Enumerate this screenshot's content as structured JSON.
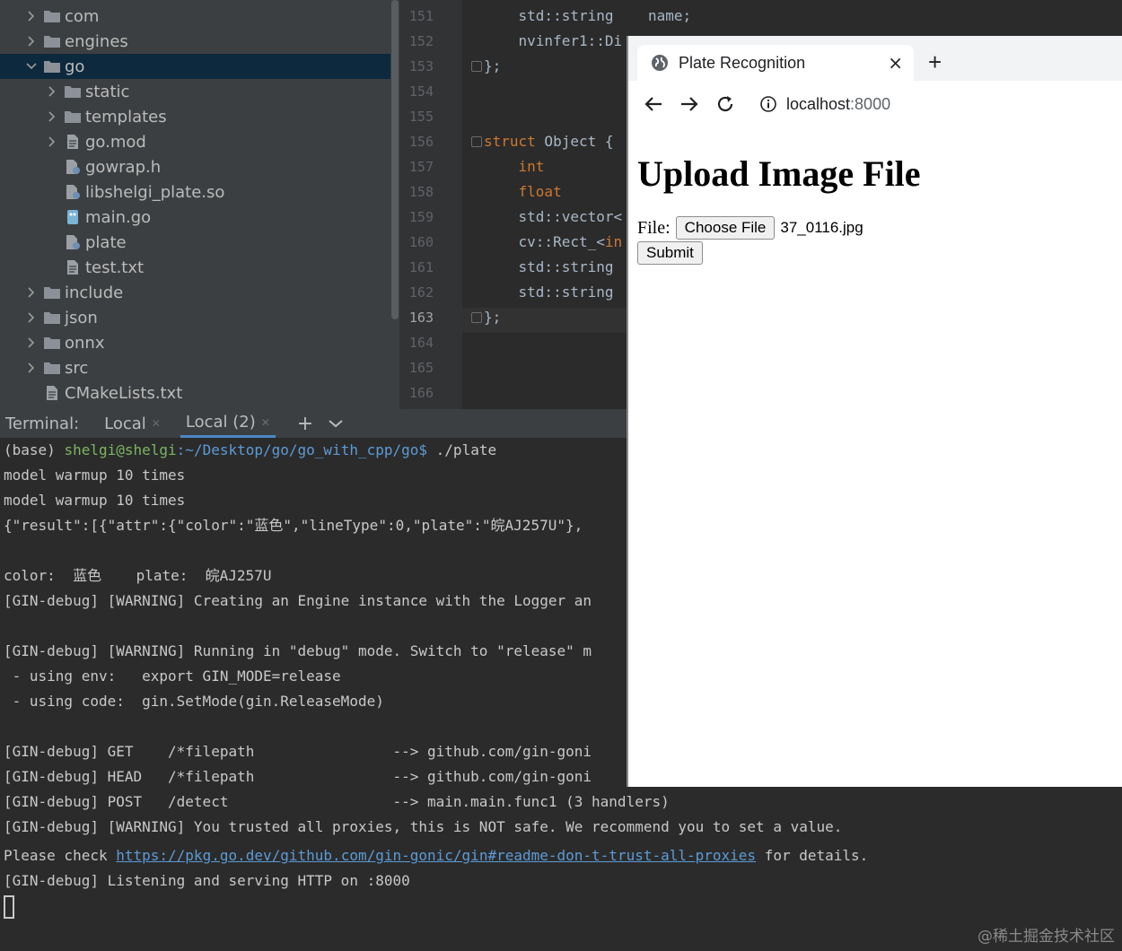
{
  "project_tree": {
    "items": [
      {
        "label": "com",
        "type": "folder",
        "chevron": "›",
        "indent": 0
      },
      {
        "label": "engines",
        "type": "folder",
        "chevron": "›",
        "indent": 0
      },
      {
        "label": "go",
        "type": "folder",
        "chevron": "⌄",
        "indent": 0,
        "selected": true
      },
      {
        "label": "static",
        "type": "folder",
        "chevron": "›",
        "indent": 1
      },
      {
        "label": "templates",
        "type": "folder",
        "chevron": "›",
        "indent": 1
      },
      {
        "label": "go.mod",
        "type": "file",
        "chevron": "›",
        "indent": 1
      },
      {
        "label": "gowrap.h",
        "type": "lib-file",
        "chevron": "",
        "indent": 1
      },
      {
        "label": "libshelgi_plate.so",
        "type": "lib-file",
        "chevron": "",
        "indent": 1
      },
      {
        "label": "main.go",
        "type": "go-file",
        "chevron": "",
        "indent": 1
      },
      {
        "label": "plate",
        "type": "lib-file",
        "chevron": "",
        "indent": 1
      },
      {
        "label": "test.txt",
        "type": "file",
        "chevron": "",
        "indent": 1
      },
      {
        "label": "include",
        "type": "folder",
        "chevron": "›",
        "indent": 0
      },
      {
        "label": "json",
        "type": "folder",
        "chevron": "›",
        "indent": 0
      },
      {
        "label": "onnx",
        "type": "folder",
        "chevron": "›",
        "indent": 0
      },
      {
        "label": "src",
        "type": "folder",
        "chevron": "›",
        "indent": 0
      },
      {
        "label": "CMakeLists.txt",
        "type": "file",
        "chevron": "",
        "indent": 0
      }
    ]
  },
  "editor": {
    "current_line": "163",
    "lines": [
      {
        "num": "151",
        "code": "    std::string    name;",
        "kw": ""
      },
      {
        "num": "152",
        "code": "    nvinfer1::Di",
        "kw": ""
      },
      {
        "num": "153",
        "code": "};",
        "kw": ""
      },
      {
        "num": "154",
        "code": "",
        "kw": ""
      },
      {
        "num": "155",
        "code": "",
        "kw": ""
      },
      {
        "num": "156",
        "code": " Object {",
        "kw": "struct"
      },
      {
        "num": "157",
        "code": "",
        "kw": "    int"
      },
      {
        "num": "158",
        "code": "",
        "kw": "    float"
      },
      {
        "num": "159",
        "code": "    std::vector<",
        "kw": ""
      },
      {
        "num": "160",
        "code": "    cv::Rect_<",
        "kw": "",
        "tail": "in"
      },
      {
        "num": "161",
        "code": "    std::string",
        "kw": ""
      },
      {
        "num": "162",
        "code": "    std::string",
        "kw": ""
      },
      {
        "num": "163",
        "code": "};",
        "kw": ""
      },
      {
        "num": "164",
        "code": "",
        "kw": ""
      },
      {
        "num": "165",
        "code": "",
        "kw": ""
      },
      {
        "num": "166",
        "code": "",
        "kw": ""
      }
    ]
  },
  "terminal_tabs": {
    "title": "Terminal:",
    "tabs": [
      {
        "label": "Local",
        "active": false
      },
      {
        "label": "Local (2)",
        "active": true
      }
    ],
    "add": "+",
    "more": "⌄"
  },
  "terminal": {
    "prompt_env": "(base) ",
    "prompt_user": "shelgi@shelgi",
    "prompt_path": ":~/Desktop/go/go_with_cpp/go$",
    "prompt_cmd": " ./plate",
    "lines": [
      "model warmup 10 times",
      "model warmup 10 times",
      "{\"result\":[{\"attr\":{\"color\":\"蓝色\",\"lineType\":0,\"plate\":\"皖AJ257U\"},",
      "",
      "color:  蓝色    plate:  皖AJ257U",
      "[GIN-debug] [WARNING] Creating an Engine instance with the Logger an",
      "",
      "[GIN-debug] [WARNING] Running in \"debug\" mode. Switch to \"release\" m",
      " - using env:   export GIN_MODE=release",
      " - using code:  gin.SetMode(gin.ReleaseMode)",
      "",
      "[GIN-debug] GET    /*filepath                --> github.com/gin-goni",
      "[GIN-debug] HEAD   /*filepath                --> github.com/gin-goni",
      "[GIN-debug] POST   /detect                   --> main.main.func1 (3 handlers)",
      "[GIN-debug] [WARNING] You trusted all proxies, this is NOT safe. We recommend you to set a value."
    ],
    "check_prefix": "Please check ",
    "check_link": "https://pkg.go.dev/github.com/gin-gonic/gin#readme-don-t-trust-all-proxies",
    "check_suffix": " for details.",
    "listening": "[GIN-debug] Listening and serving HTTP on :8000"
  },
  "browser": {
    "tab_title": "Plate Recognition",
    "tab_close": "×",
    "new_tab": "+",
    "url_host": "localhost",
    "url_port": ":8000",
    "heading": "Upload Image File",
    "file_label": "File:",
    "choose_file": "Choose File",
    "file_name": "37_0116.jpg",
    "submit": "Submit"
  },
  "watermark": "@稀土掘金技术社区",
  "colors": {
    "tree_bg": "#3c3f41",
    "selection": "#0d293e",
    "editor_bg": "#2b2b2b",
    "keyword": "#cc7832",
    "prompt_green": "#7bb661",
    "path_blue": "#5c9bd6"
  }
}
